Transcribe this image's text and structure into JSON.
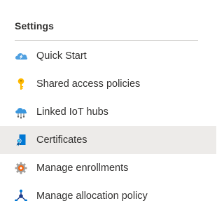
{
  "section": {
    "title": "Settings"
  },
  "menu": {
    "items": [
      {
        "label": "Quick Start",
        "icon": "quick-start-cloud-icon",
        "selected": false
      },
      {
        "label": "Shared access policies",
        "icon": "key-icon",
        "selected": false
      },
      {
        "label": "Linked IoT hubs",
        "icon": "iot-hub-icon",
        "selected": false
      },
      {
        "label": "Certificates",
        "icon": "certificate-icon",
        "selected": true
      },
      {
        "label": "Manage enrollments",
        "icon": "gear-icon",
        "selected": false
      },
      {
        "label": "Manage allocation policy",
        "icon": "allocation-network-icon",
        "selected": false
      }
    ]
  },
  "colors": {
    "selected_background": "#edebe9",
    "text": "#323130",
    "divider": "#c8c6c4",
    "azure_blue": "#0078d4",
    "key_yellow": "#ffb900",
    "gear_orange": "#d83b01"
  }
}
